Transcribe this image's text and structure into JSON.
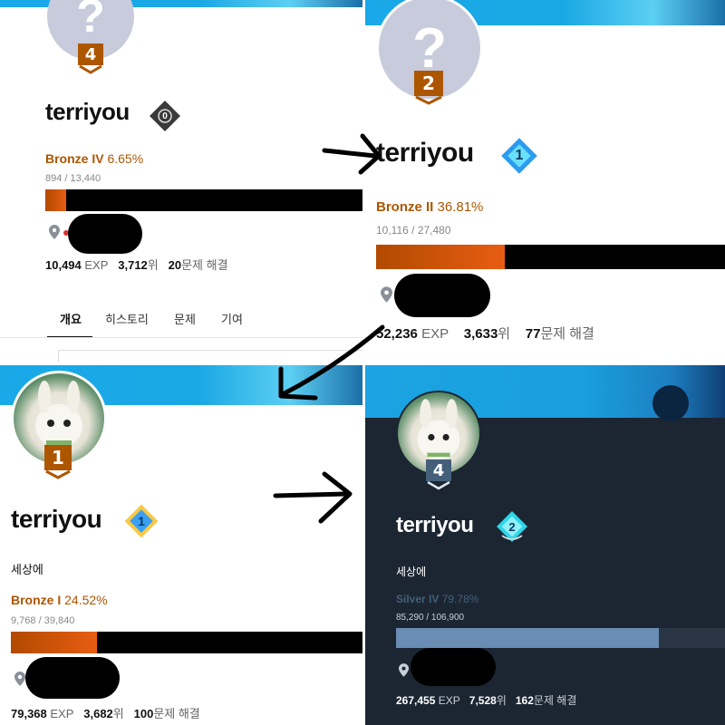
{
  "panels": [
    {
      "username": "terriyou",
      "flag_number": "4",
      "badge_number": "0",
      "tier_name": "Bronze IV",
      "tier_percent": "6.65%",
      "exp_progress": "894 / 13,440",
      "progress_fraction": 0.0665,
      "total_exp": "10,494",
      "exp_label": "EXP",
      "rank": "3,712",
      "rank_suffix": "위",
      "solved": "20",
      "solved_suffix": "문제 해결",
      "tabs": [
        "개요",
        "히스토리",
        "문제",
        "기여"
      ]
    },
    {
      "username": "terriyou",
      "flag_number": "2",
      "badge_number": "1",
      "tier_name": "Bronze II",
      "tier_percent": "36.81%",
      "exp_progress": "10,116 / 27,480",
      "progress_fraction": 0.3681,
      "total_exp": "52,236",
      "exp_label": "EXP",
      "rank": "3,633",
      "rank_suffix": "위",
      "solved": "77",
      "solved_suffix": "문제 해결"
    },
    {
      "username": "terriyou",
      "flag_number": "1",
      "badge_number": "1",
      "bio": "세상에",
      "tier_name": "Bronze I",
      "tier_percent": "24.52%",
      "exp_progress": "9,768 / 39,840",
      "progress_fraction": 0.2452,
      "total_exp": "79,368",
      "exp_label": "EXP",
      "rank": "3,682",
      "rank_suffix": "위",
      "solved": "100",
      "solved_suffix": "문제 해결"
    },
    {
      "username": "terriyou",
      "flag_number": "4",
      "badge_number": "2",
      "bio": "세상에",
      "tier_name": "Silver IV",
      "tier_percent": "79.78%",
      "exp_progress": "85,290 / 106,900",
      "progress_fraction": 0.7978,
      "total_exp": "267,455",
      "exp_label": "EXP",
      "rank": "7,528",
      "rank_suffix": "위",
      "solved": "162",
      "solved_suffix": "문제 해결"
    }
  ],
  "colors": {
    "bronze": "#ad5600",
    "silver": "#435f7a",
    "diamond_blue": "#26a7f0",
    "dark_bg": "#1c2632"
  },
  "icons": [
    "question-mark-icon",
    "location-pin-icon",
    "arrow-icon"
  ]
}
